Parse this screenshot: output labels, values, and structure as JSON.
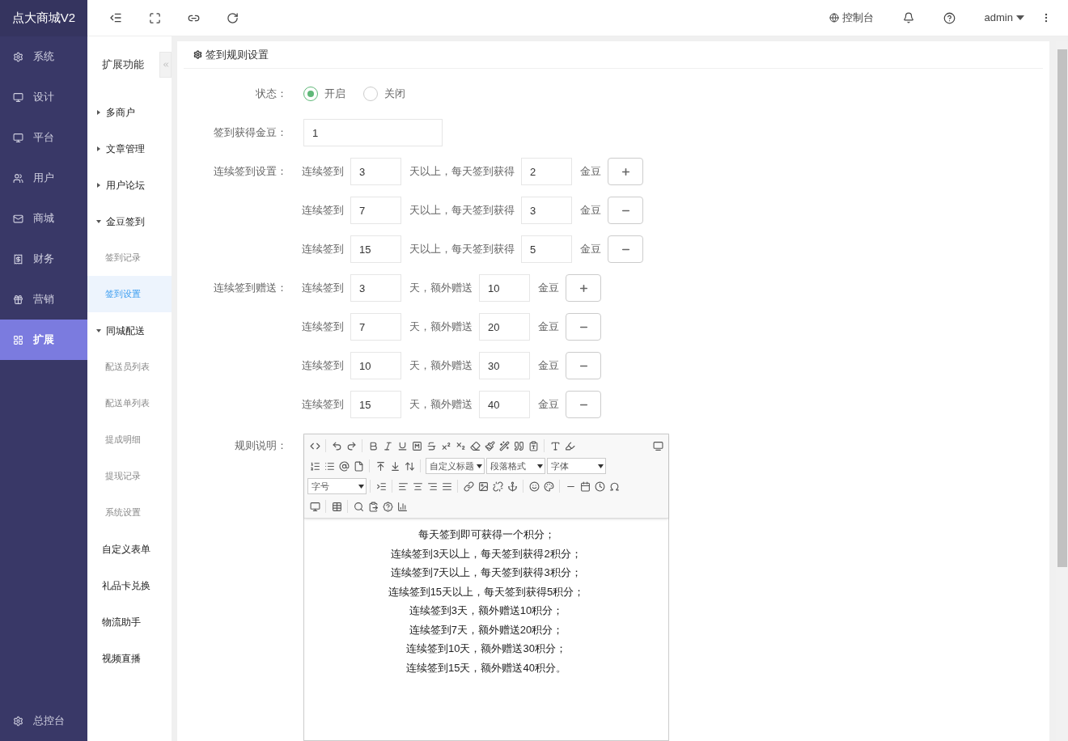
{
  "brand": "点大商城V2",
  "main_nav": [
    {
      "label": "系统",
      "selected": false
    },
    {
      "label": "设计",
      "selected": false
    },
    {
      "label": "平台",
      "selected": false
    },
    {
      "label": "用户",
      "selected": false
    },
    {
      "label": "商城",
      "selected": false
    },
    {
      "label": "财务",
      "selected": false
    },
    {
      "label": "营销",
      "selected": false
    },
    {
      "label": "扩展",
      "selected": true
    }
  ],
  "main_nav_footer": "总控台",
  "topbar": {
    "console": "控制台",
    "user": "admin"
  },
  "sub_nav": {
    "title": "扩展功能",
    "items": [
      {
        "label": "多商户",
        "expanded": false
      },
      {
        "label": "文章管理",
        "expanded": false
      },
      {
        "label": "用户论坛",
        "expanded": false
      },
      {
        "label": "金豆签到",
        "expanded": true,
        "children": [
          {
            "label": "签到记录",
            "selected": false
          },
          {
            "label": "签到设置",
            "selected": true
          }
        ]
      },
      {
        "label": "同城配送",
        "expanded": true,
        "children": [
          {
            "label": "配送员列表",
            "selected": false
          },
          {
            "label": "配送单列表",
            "selected": false
          },
          {
            "label": "提成明细",
            "selected": false
          },
          {
            "label": "提现记录",
            "selected": false
          },
          {
            "label": "系统设置",
            "selected": false
          }
        ]
      },
      {
        "label": "自定义表单"
      },
      {
        "label": "礼品卡兑换"
      },
      {
        "label": "物流助手"
      },
      {
        "label": "视频直播"
      }
    ]
  },
  "card_title": "签到规则设置",
  "status": {
    "label": "状态：",
    "options": [
      {
        "label": "开启",
        "selected": true
      },
      {
        "label": "关闭",
        "selected": false
      }
    ]
  },
  "daily": {
    "label": "签到获得金豆：",
    "value": "1"
  },
  "groups": [
    {
      "label": "连续签到设置：",
      "rows": [
        {
          "prefix": "连续签到",
          "days": "3",
          "middle": "天以上，每天签到获得",
          "amount": "2",
          "unit": "金豆",
          "kind": "add"
        },
        {
          "prefix": "连续签到",
          "days": "7",
          "middle": "天以上，每天签到获得",
          "amount": "3",
          "unit": "金豆",
          "kind": "remove"
        },
        {
          "prefix": "连续签到",
          "days": "15",
          "middle": "天以上，每天签到获得",
          "amount": "5",
          "unit": "金豆",
          "kind": "remove"
        }
      ]
    },
    {
      "label": "连续签到赠送：",
      "rows": [
        {
          "prefix": "连续签到",
          "days": "3",
          "middle": "天，额外赠送",
          "amount": "10",
          "unit": "金豆",
          "kind": "add"
        },
        {
          "prefix": "连续签到",
          "days": "7",
          "middle": "天，额外赠送",
          "amount": "20",
          "unit": "金豆",
          "kind": "remove"
        },
        {
          "prefix": "连续签到",
          "days": "10",
          "middle": "天，额外赠送",
          "amount": "30",
          "unit": "金豆",
          "kind": "remove"
        },
        {
          "prefix": "连续签到",
          "days": "15",
          "middle": "天，额外赠送",
          "amount": "40",
          "unit": "金豆",
          "kind": "remove"
        }
      ]
    }
  ],
  "rules": {
    "label": "规则说明：",
    "dropdowns": [
      "自定义标题",
      "段落格式",
      "字体",
      "字号"
    ],
    "lines": [
      "每天签到即可获得一个积分；",
      "连续签到3天以上，每天签到获得2积分；",
      "连续签到7天以上，每天签到获得3积分；",
      "连续签到15天以上，每天签到获得5积分；",
      "连续签到3天，额外赠送10积分；",
      "连续签到7天，额外赠送20积分；",
      "连续签到10天，额外赠送30积分；",
      "连续签到15天，额外赠送40积分。"
    ]
  }
}
